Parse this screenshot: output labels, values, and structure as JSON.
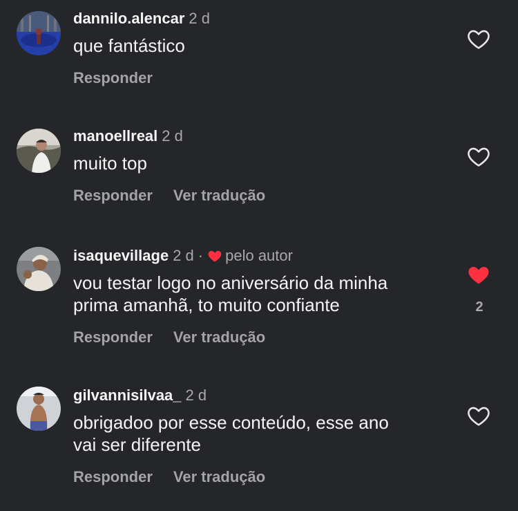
{
  "colors": {
    "background": "#25262a",
    "like_active": "#ff3040",
    "secondary_text": "#a8a9ad"
  },
  "comments": [
    {
      "username": "dannilo.alencar",
      "time": "2 d",
      "text_lines": [
        "que fantástico"
      ],
      "reply_label": "Responder",
      "liked": false,
      "like_icon": "heart-outline-icon"
    },
    {
      "username": "manoellreal",
      "time": "2 d",
      "text_lines": [
        "muito top"
      ],
      "reply_label": "Responder",
      "translate_label": "Ver tradução",
      "liked": false,
      "like_icon": "heart-outline-icon"
    },
    {
      "username": "isaquevillage",
      "time": "2 d",
      "separator": "·",
      "author_liked_label": "pelo autor",
      "author_liked_icon": "heart-filled-icon",
      "text_lines": [
        "vou testar logo no aniversário da minha",
        "prima amanhã, to muito confiante"
      ],
      "reply_label": "Responder",
      "translate_label": "Ver tradução",
      "liked": true,
      "like_icon": "heart-filled-icon",
      "like_count": "2"
    },
    {
      "username": "gilvannisilvaa_",
      "time": "2 d",
      "text_lines": [
        "obrigadoo por esse conteúdo, esse ano",
        "vai ser diferente"
      ],
      "reply_label": "Responder",
      "translate_label": "Ver tradução",
      "liked": false,
      "like_icon": "heart-outline-icon"
    }
  ]
}
